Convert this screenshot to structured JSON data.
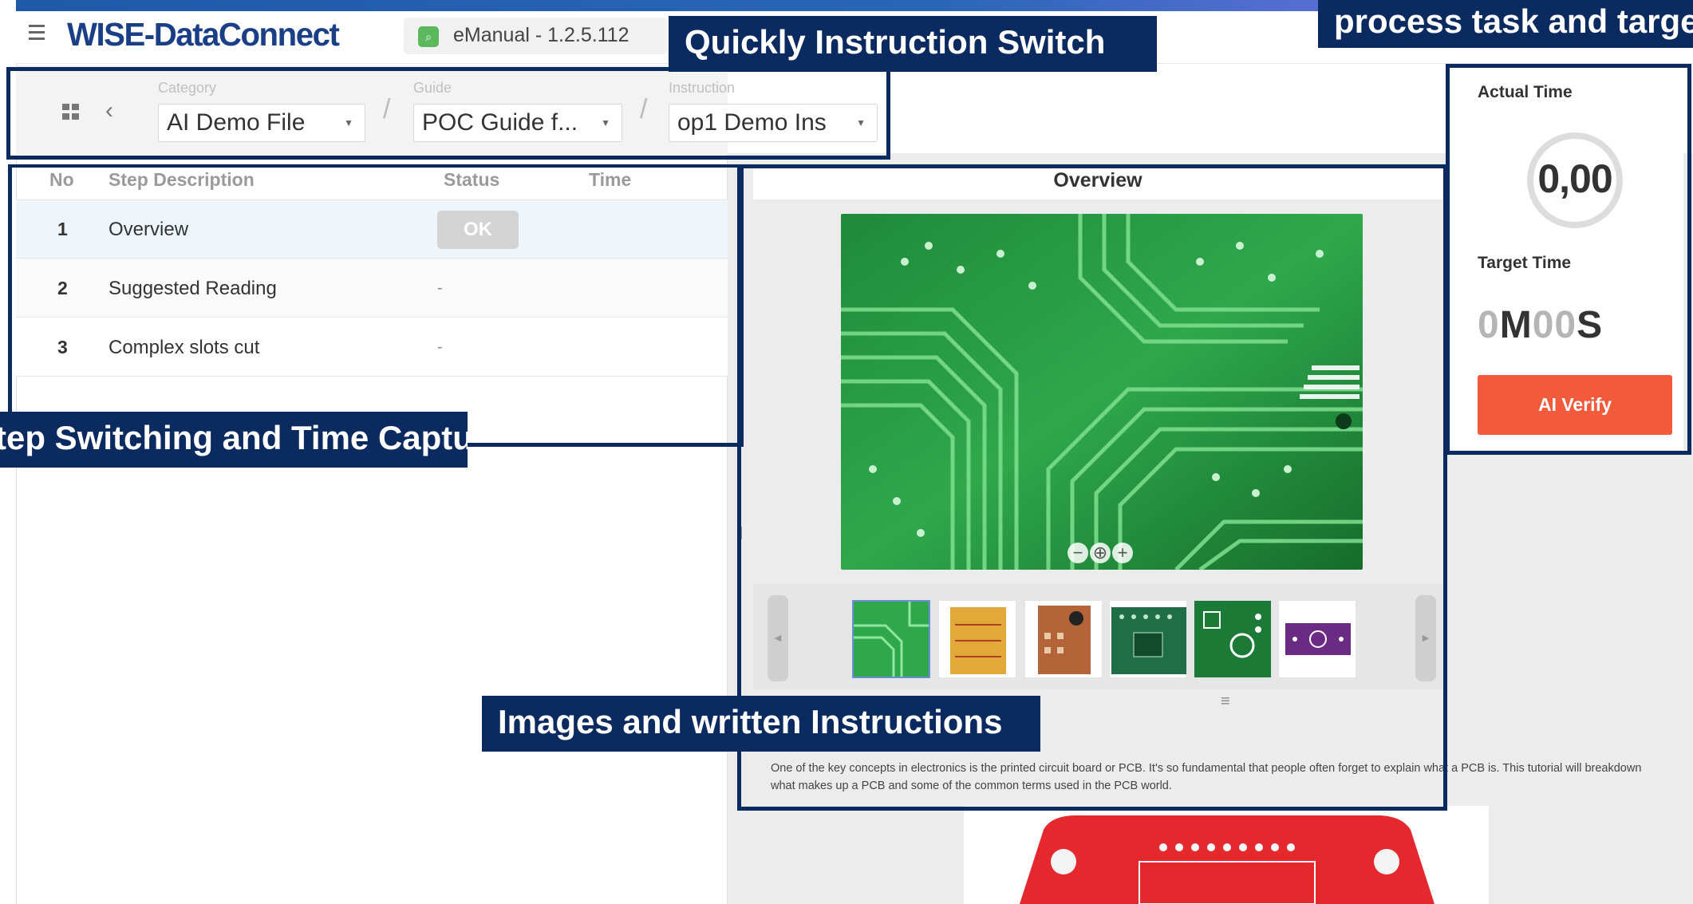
{
  "header": {
    "logo_text": "WISE-DataConnect",
    "app_title": "eManual - 1.2.5.112",
    "accent_color": "#1e5aa8"
  },
  "nav": {
    "selectors": [
      {
        "label": "Category",
        "value": "AI Demo File"
      },
      {
        "label": "Guide",
        "value": "POC Guide f..."
      },
      {
        "label": "Instruction",
        "value": "op1 Demo Ins"
      }
    ],
    "separator": "/"
  },
  "steps": {
    "columns": [
      "No",
      "Step Description",
      "Status",
      "Time"
    ],
    "rows": [
      {
        "no": "1",
        "description": "Overview",
        "status": "OK",
        "time": ""
      },
      {
        "no": "2",
        "description": "Suggested Reading",
        "status": "-",
        "time": ""
      },
      {
        "no": "3",
        "description": "Complex slots cut",
        "status": "-",
        "time": ""
      }
    ],
    "selected_row_color": "#eef6fb"
  },
  "overview": {
    "title": "Overview",
    "zoom_out": "−",
    "zoom_reset": "⊕",
    "zoom_in": "+",
    "thumbnail_count": 6,
    "description": "One of the key concepts in electronics is the printed circuit board or PCB. It's so fundamental that people often forget to explain what a PCB is. This tutorial will breakdown what makes up a PCB and some of the common terms used in the PCB world."
  },
  "timer": {
    "actual_label": "Actual Time",
    "actual_value": "0,00",
    "target_label": "Target Time",
    "target_parts": [
      "0",
      "M",
      "00",
      "S"
    ],
    "verify_label": "AI Verify",
    "verify_color": "#f15a3b"
  },
  "callouts": [
    {
      "text": "Quickly Instruction Switch"
    },
    {
      "text": "process task and target time"
    },
    {
      "text": "Step Switching and Time Capture"
    },
    {
      "text": "Images and written Instructions"
    }
  ]
}
